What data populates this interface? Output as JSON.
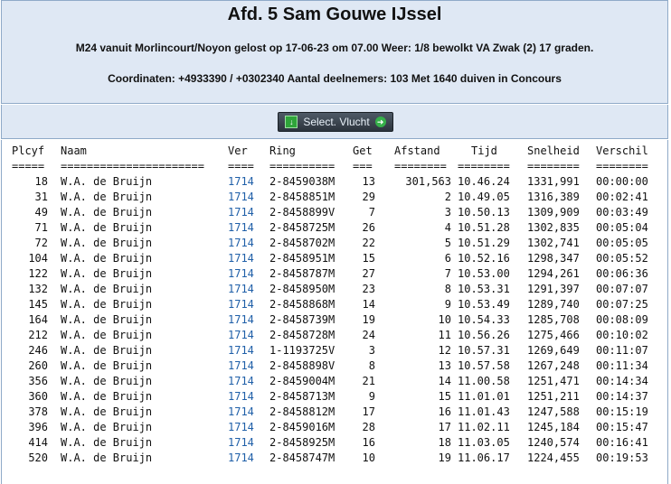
{
  "header": {
    "title": "Afd. 5 Sam Gouwe IJssel",
    "line1": "M24 vanuit Morlincourt/Noyon gelost op 17-06-23 om 07.00 Weer: 1/8 bewolkt VA Zwak (2) 17 graden.",
    "line2": "Coordinaten: +4933390 / +0302340 Aantal deelnemers: 103 Met 1640 duiven in Concours"
  },
  "toolbar": {
    "select_label": "Select. Vlucht",
    "select_icon": "download-icon",
    "arrow_icon": "arrow-right-icon"
  },
  "table": {
    "columns": [
      "Plcyf",
      "Naam",
      "Ver",
      "Ring",
      "Get",
      "Afstand",
      "Tijd",
      "Snelheid",
      "Verschil"
    ],
    "separators": [
      "=====",
      "======================",
      "====",
      "==========",
      "===",
      "========",
      "========",
      "========",
      "========"
    ],
    "rows": [
      [
        "18",
        "W.A. de Bruijn",
        "1714",
        "2-8459038M",
        "13",
        "301,563",
        "10.46.24",
        "1331,991",
        "00:00:00"
      ],
      [
        "31",
        "W.A. de Bruijn",
        "1714",
        "2-8458851M",
        "29",
        "2",
        "10.49.05",
        "1316,389",
        "00:02:41"
      ],
      [
        "49",
        "W.A. de Bruijn",
        "1714",
        "2-8458899V",
        "7",
        "3",
        "10.50.13",
        "1309,909",
        "00:03:49"
      ],
      [
        "71",
        "W.A. de Bruijn",
        "1714",
        "2-8458725M",
        "26",
        "4",
        "10.51.28",
        "1302,835",
        "00:05:04"
      ],
      [
        "72",
        "W.A. de Bruijn",
        "1714",
        "2-8458702M",
        "22",
        "5",
        "10.51.29",
        "1302,741",
        "00:05:05"
      ],
      [
        "104",
        "W.A. de Bruijn",
        "1714",
        "2-8458951M",
        "15",
        "6",
        "10.52.16",
        "1298,347",
        "00:05:52"
      ],
      [
        "122",
        "W.A. de Bruijn",
        "1714",
        "2-8458787M",
        "27",
        "7",
        "10.53.00",
        "1294,261",
        "00:06:36"
      ],
      [
        "132",
        "W.A. de Bruijn",
        "1714",
        "2-8458950M",
        "23",
        "8",
        "10.53.31",
        "1291,397",
        "00:07:07"
      ],
      [
        "145",
        "W.A. de Bruijn",
        "1714",
        "2-8458868M",
        "14",
        "9",
        "10.53.49",
        "1289,740",
        "00:07:25"
      ],
      [
        "164",
        "W.A. de Bruijn",
        "1714",
        "2-8458739M",
        "19",
        "10",
        "10.54.33",
        "1285,708",
        "00:08:09"
      ],
      [
        "212",
        "W.A. de Bruijn",
        "1714",
        "2-8458728M",
        "24",
        "11",
        "10.56.26",
        "1275,466",
        "00:10:02"
      ],
      [
        "246",
        "W.A. de Bruijn",
        "1714",
        "1-1193725V",
        "3",
        "12",
        "10.57.31",
        "1269,649",
        "00:11:07"
      ],
      [
        "260",
        "W.A. de Bruijn",
        "1714",
        "2-8458898V",
        "8",
        "13",
        "10.57.58",
        "1267,248",
        "00:11:34"
      ],
      [
        "356",
        "W.A. de Bruijn",
        "1714",
        "2-8459004M",
        "21",
        "14",
        "11.00.58",
        "1251,471",
        "00:14:34"
      ],
      [
        "360",
        "W.A. de Bruijn",
        "1714",
        "2-8458713M",
        "9",
        "15",
        "11.01.01",
        "1251,211",
        "00:14:37"
      ],
      [
        "378",
        "W.A. de Bruijn",
        "1714",
        "2-8458812M",
        "17",
        "16",
        "11.01.43",
        "1247,588",
        "00:15:19"
      ],
      [
        "396",
        "W.A. de Bruijn",
        "1714",
        "2-8459016M",
        "28",
        "17",
        "11.02.11",
        "1245,184",
        "00:15:47"
      ],
      [
        "414",
        "W.A. de Bruijn",
        "1714",
        "2-8458925M",
        "16",
        "18",
        "11.03.05",
        "1240,574",
        "00:16:41"
      ],
      [
        "520",
        "W.A. de Bruijn",
        "1714",
        "2-8458747M",
        "10",
        "19",
        "11.06.17",
        "1224,455",
        "00:19:53"
      ]
    ]
  }
}
